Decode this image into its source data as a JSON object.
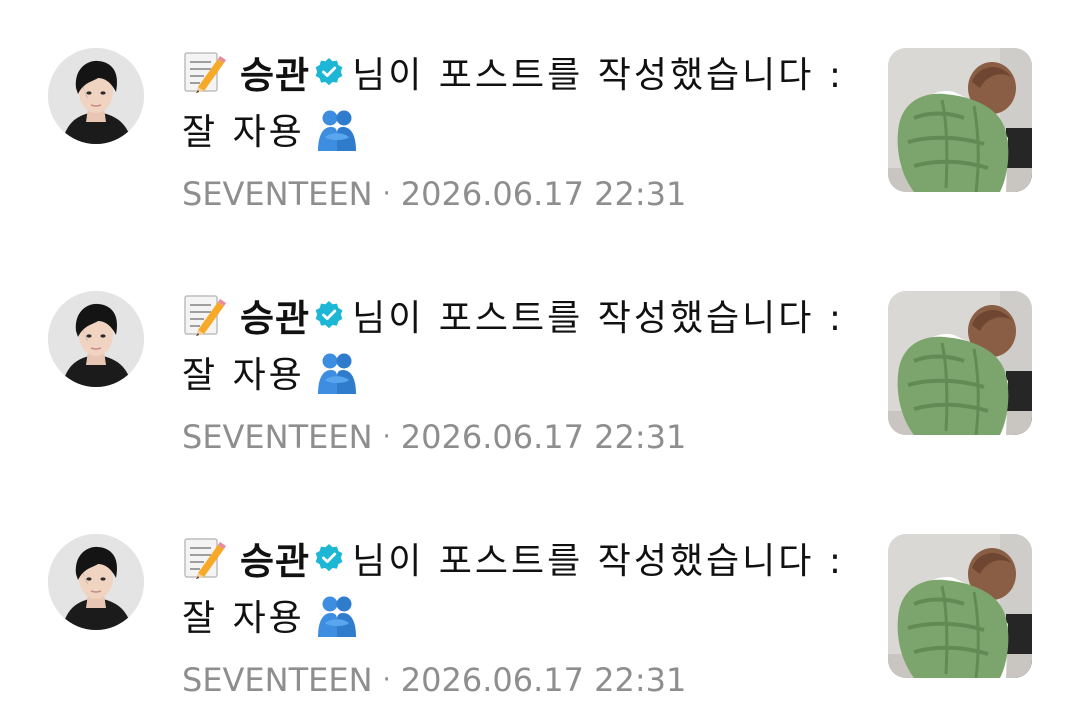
{
  "notifications": [
    {
      "author": "승관",
      "message": "님이 포스트를 작성했습니다 :",
      "message_line2": "잘 자용",
      "artist": "SEVENTEEN",
      "separator": "·",
      "timestamp": "2026.06.17 22:31",
      "icons": {
        "leading": "memo-icon",
        "verified": "verified-badge-icon",
        "trailing": "people-hugging-icon"
      }
    },
    {
      "author": "승관",
      "message": "님이 포스트를 작성했습니다 :",
      "message_line2": "잘 자용",
      "artist": "SEVENTEEN",
      "separator": "·",
      "timestamp": "2026.06.17 22:31",
      "icons": {
        "leading": "memo-icon",
        "verified": "verified-badge-icon",
        "trailing": "people-hugging-icon"
      }
    },
    {
      "author": "승관",
      "message": "님이 포스트를 작성했습니다 :",
      "message_line2": "잘 자용",
      "artist": "SEVENTEEN",
      "separator": "·",
      "timestamp": "2026.06.17 22:31",
      "icons": {
        "leading": "memo-icon",
        "verified": "verified-badge-icon",
        "trailing": "people-hugging-icon"
      }
    }
  ],
  "colors": {
    "text_primary": "#111111",
    "text_meta": "#8e8e8e",
    "verified_badge": "#1db7d6",
    "background": "#ffffff"
  }
}
